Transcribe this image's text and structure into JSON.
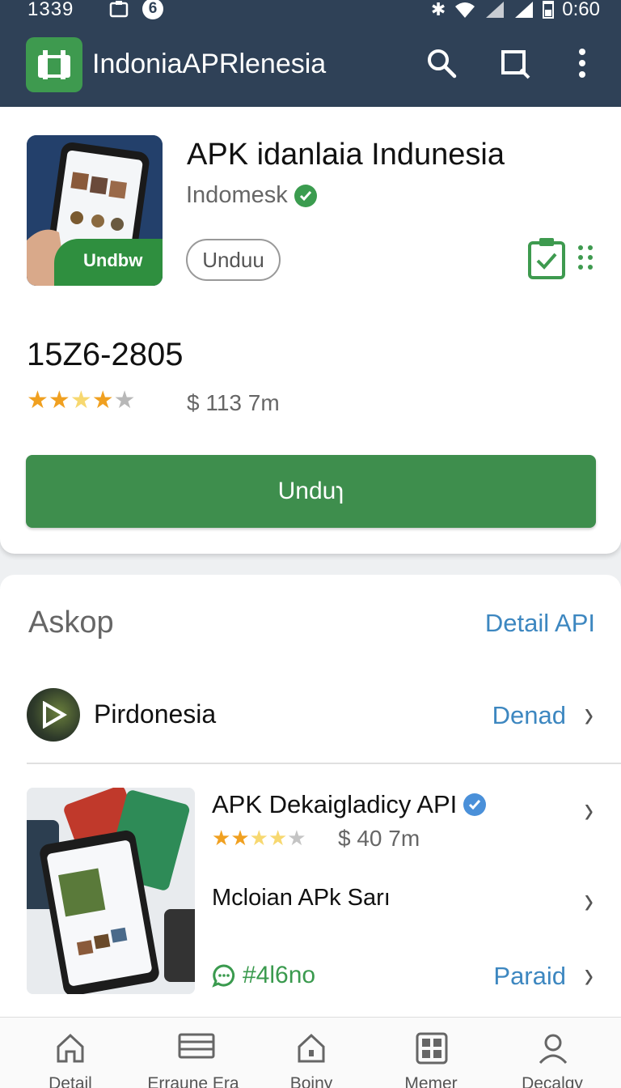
{
  "status_bar": {
    "time": "1339",
    "notif_count": "6",
    "clock_right": "0:60"
  },
  "app_bar": {
    "app_name": "IndoniaAPRlenesia",
    "icons": [
      "search-icon",
      "crop-icon",
      "more-vert-icon"
    ]
  },
  "app_card": {
    "title": "APK idanlaia Indunesia",
    "developer": "Indomesk",
    "chip_label": "Unduu",
    "thumb_badge": "Undbw",
    "code": "15Z6-2805",
    "rating_stars": 3.5,
    "rating_meta": "$ 113 7m",
    "cta_label": "Unduɿ",
    "icons": [
      "clipboard-check-icon",
      "drag-dots-icon"
    ]
  },
  "section": {
    "title": "Askop",
    "link": "Detail API",
    "rows": [
      {
        "title": "Pirdonesia",
        "link": "Denad"
      },
      {
        "title": "APK Dekaigladicy API",
        "rating_stars": 3,
        "meta": "$ 40 7m"
      },
      {
        "title": "Mcloian APk Sarı"
      },
      {
        "text": "#4l6no",
        "link": "Paraid"
      }
    ]
  },
  "bottom_nav": [
    {
      "label": "Detail",
      "icon": "home-icon"
    },
    {
      "label": "Erraune Era",
      "icon": "list-icon"
    },
    {
      "label": "Boiny",
      "icon": "home-outline-icon"
    },
    {
      "label": "Memer",
      "icon": "grid-icon"
    },
    {
      "label": "Decalqy",
      "icon": "profile-icon"
    }
  ],
  "colors": {
    "app_bar": "#2f4157",
    "accent_green": "#3e8e4d",
    "link_blue": "#3d87c0",
    "star": "#f0a020"
  }
}
